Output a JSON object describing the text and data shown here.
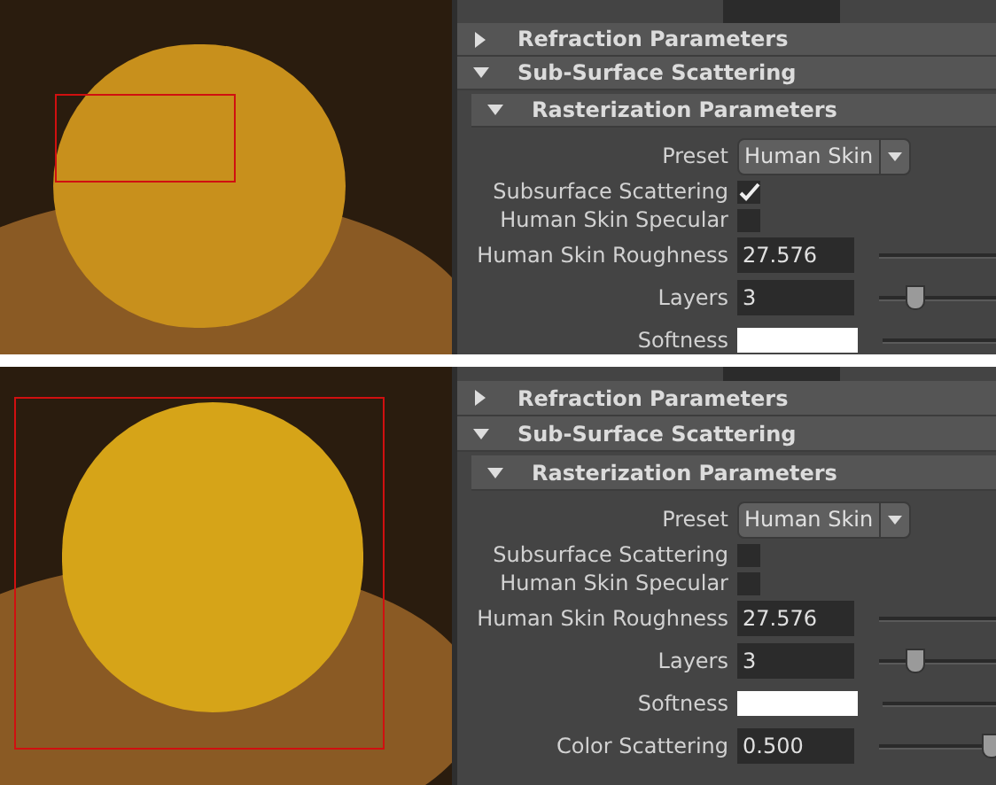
{
  "panels": [
    {
      "sections": [
        {
          "title": "Refraction Parameters",
          "expanded": false
        },
        {
          "title": "Sub-Surface Scattering",
          "expanded": true
        },
        {
          "title": "Rasterization Parameters",
          "expanded": true
        }
      ],
      "attributes": [
        {
          "kind": "dropdown",
          "label": "Preset",
          "value": "Human Skin"
        },
        {
          "kind": "checkbox",
          "label": "Subsurface Scattering",
          "checked": true
        },
        {
          "kind": "checkbox",
          "label": "Human Skin Specular",
          "checked": false
        },
        {
          "kind": "slider",
          "label": "Human Skin Roughness",
          "value": "27.576"
        },
        {
          "kind": "slider",
          "label": "Layers",
          "value": "3",
          "level": 0.32
        },
        {
          "kind": "color",
          "label": "Softness"
        }
      ]
    },
    {
      "sections": [
        {
          "title": "Refraction Parameters",
          "expanded": false
        },
        {
          "title": "Sub-Surface Scattering",
          "expanded": true
        },
        {
          "title": "Rasterization Parameters",
          "expanded": true
        }
      ],
      "attributes": [
        {
          "kind": "dropdown",
          "label": "Preset",
          "value": "Human Skin"
        },
        {
          "kind": "checkbox",
          "label": "Subsurface Scattering",
          "checked": false
        },
        {
          "kind": "checkbox",
          "label": "Human Skin Specular",
          "checked": false
        },
        {
          "kind": "slider",
          "label": "Human Skin Roughness",
          "value": "27.576"
        },
        {
          "kind": "slider",
          "label": "Layers",
          "value": "3",
          "level": 0.32
        },
        {
          "kind": "color",
          "label": "Softness"
        },
        {
          "kind": "slider",
          "label": "Color Scattering",
          "value": "0.500",
          "level": 0.97
        }
      ]
    }
  ]
}
